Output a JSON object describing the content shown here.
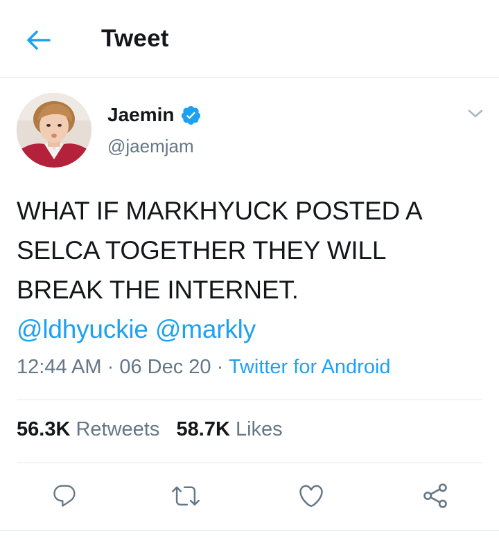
{
  "header": {
    "title": "Tweet"
  },
  "author": {
    "name": "Jaemin",
    "handle": "@jaemjam",
    "verified": true
  },
  "tweet": {
    "text_lines": [
      "WHAT IF MARKHYUCK POSTED A",
      "SELCA TOGETHER THEY WILL",
      "BREAK THE INTERNET."
    ],
    "mentions": [
      "@ldhyuckie",
      "@markly"
    ],
    "time": "12:44 AM",
    "date": "06 Dec 20",
    "separator": "·",
    "source": "Twitter for Android"
  },
  "stats": {
    "retweets_count": "56.3K",
    "retweets_label": "Retweets",
    "likes_count": "58.7K",
    "likes_label": "Likes"
  },
  "icons": {
    "back": "arrow-left-icon",
    "verified": "verified-badge-icon",
    "caret": "chevron-down-icon",
    "reply": "reply-icon",
    "retweet": "retweet-icon",
    "like": "heart-icon",
    "share": "share-icon"
  },
  "colors": {
    "accent": "#1da1f2",
    "text": "#14171a",
    "muted": "#657786",
    "divider": "#e1e8ed"
  }
}
